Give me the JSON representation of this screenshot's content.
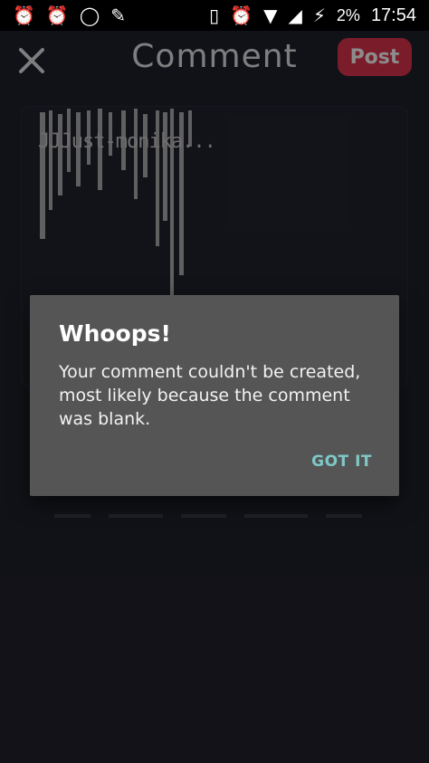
{
  "status_bar": {
    "left_icons": [
      "alarm-icon",
      "alarm-icon",
      "whatsapp-icon",
      "pen-icon"
    ],
    "battery_text": "2%",
    "time": "17:54"
  },
  "header": {
    "title": "Comment",
    "post_label": "Post",
    "post_color": "#e0334f"
  },
  "comment": {
    "username": "JJJust-monika..."
  },
  "dialog": {
    "title": "Whoops!",
    "message": "Your comment couldn't be created, most likely because the comment was blank.",
    "button_label": "GOT IT",
    "button_color": "#7fc8c8",
    "background": "#555555"
  }
}
